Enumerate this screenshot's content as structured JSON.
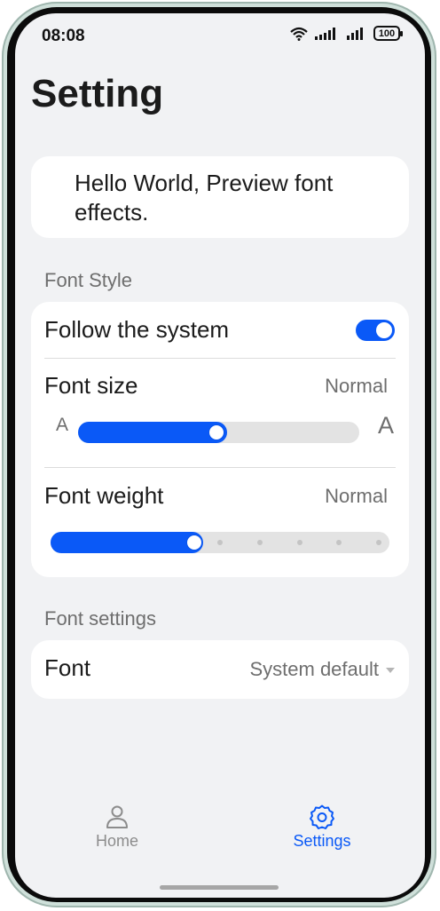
{
  "status_bar": {
    "time": "08:08",
    "battery": "100"
  },
  "page": {
    "title": "Setting"
  },
  "preview": {
    "text": "Hello World, Preview font effects."
  },
  "font_style": {
    "section_label": "Font Style",
    "follow_system": {
      "label": "Follow the system",
      "enabled": true
    },
    "font_size": {
      "label": "Font size",
      "value": "Normal",
      "small_glyph": "A",
      "large_glyph": "A",
      "level_fraction": 0.53
    },
    "font_weight": {
      "label": "Font weight",
      "value": "Normal",
      "step": 2,
      "steps": 9
    }
  },
  "font_settings": {
    "section_label": "Font settings",
    "font": {
      "label": "Font",
      "value": "System default"
    }
  },
  "tabs": [
    {
      "label": "Home",
      "icon": "person-icon",
      "active": false
    },
    {
      "label": "Settings",
      "icon": "gear-icon",
      "active": true
    }
  ],
  "colors": {
    "accent": "#0a59f7",
    "inactive_tab": "#8c8c8c",
    "background": "#f1f2f4"
  }
}
